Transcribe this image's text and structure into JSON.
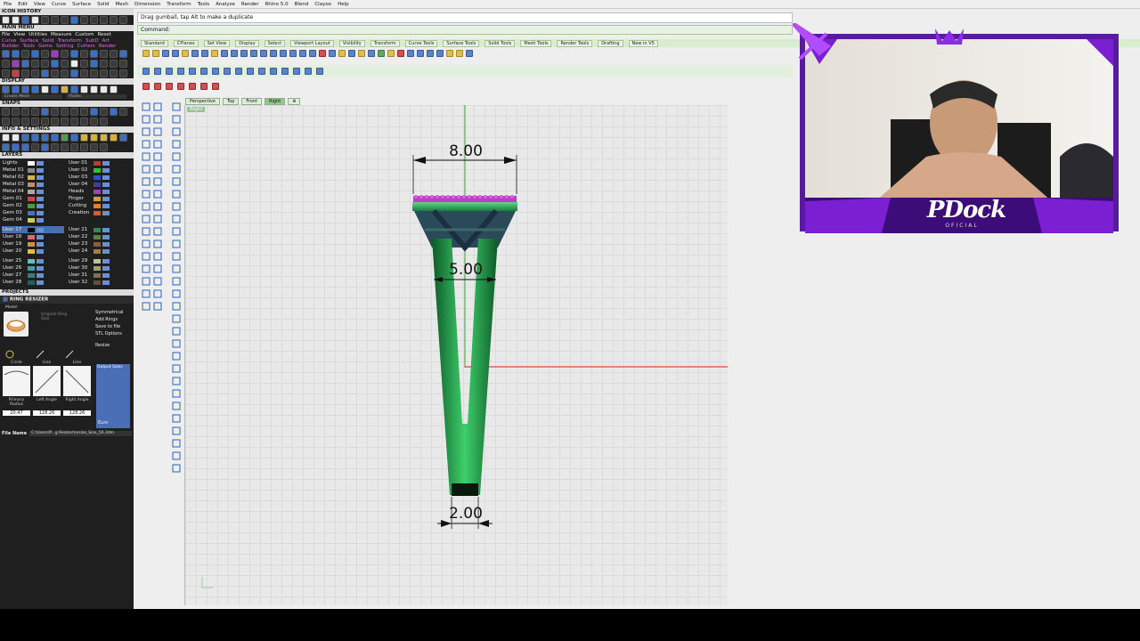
{
  "menubar": {
    "items": [
      "File",
      "Edit",
      "View",
      "Curve",
      "Surface",
      "Solid",
      "Mesh",
      "Dimension",
      "Transform",
      "Tools",
      "Analyze",
      "Render",
      "Rhino 5.0",
      "Blend",
      "Clayoo",
      "Help"
    ]
  },
  "left_panel": {
    "icon_history": "ICON HISTORY",
    "main_menu": "MAIN MENU",
    "menu_row1": [
      "File",
      "View",
      "Utilities",
      "Measure",
      "Custom",
      "Reset"
    ],
    "menu_row2": [
      "Curve",
      "Surface",
      "Solid",
      "Transform",
      "SubD",
      "Art"
    ],
    "menu_row3": [
      "Builder",
      "Tools",
      "Gems",
      "Setting",
      "Cutters",
      "Render"
    ],
    "display": "DISPLAY",
    "display_field1": "Create Mesh",
    "display_field2": "Plastic",
    "snaps": "SNAPS",
    "info_settings": "INFO & SETTINGS",
    "layers": "LAYERS",
    "layers_left": [
      "Lights",
      "Metal 01",
      "Metal 02",
      "Metal 03",
      "Metal 04",
      "Gem 01",
      "Gem 02",
      "Gem 03",
      "Gem 04",
      "User 17",
      "User 18",
      "User 19",
      "User 20",
      "User 25",
      "User 26",
      "User 27",
      "User 28"
    ],
    "layers_right": [
      "User 01",
      "User 02",
      "User 03",
      "User 04",
      "Heads",
      "Finger",
      "Cutting",
      "Creation",
      "User 21",
      "User 22",
      "User 23",
      "User 24",
      "User 29",
      "User 30",
      "User 31",
      "User 32"
    ],
    "layer_header_right": "Hide",
    "projects": "PROJECTS",
    "ring_resizer": "RING RESIZER",
    "model_label": "Model",
    "original_ring_size": "Original Ring Size",
    "options": [
      "Symmetrical",
      "Add Rings",
      "Save to file",
      "STL Options"
    ],
    "resize": "Resize",
    "output_sizes": "Output Sizes",
    "bottom_labels": [
      "Circle",
      "Line",
      "Line"
    ],
    "bottom_sub": [
      "Primary Radius",
      "Left Angle",
      "Right Angle"
    ],
    "bottom_values": [
      "20.47",
      "128.26",
      "128.26"
    ],
    "euro": "Euro",
    "file_name_label": "File Name",
    "file_name_value": "C:\\Users\\P...g Resizer\\resize_Size_56.3dm"
  },
  "status": {
    "prompt": "Drag gumball, tap Alt to make a duplicate",
    "command_label": "Command:"
  },
  "tabs": [
    "Standard",
    "CPlanes",
    "Set View",
    "Display",
    "Select",
    "Viewport Layout",
    "Visibility",
    "Transform",
    "Curve Tools",
    "Surface Tools",
    "Solid Tools",
    "Mesh Tools",
    "Render Tools",
    "Drafting",
    "New in V5"
  ],
  "viewport_tabs": [
    "Perspective",
    "Top",
    "Front",
    "Right"
  ],
  "viewport_active": "Right",
  "viewport_label": "Right",
  "dimensions": {
    "top_width": "8.00",
    "mid_width": "5.00",
    "bottom_width": "2.00"
  },
  "webcam": {
    "brand": "PDock",
    "sub": "OFICIAL"
  },
  "colors": {
    "accent_purple": "#7a1fd1",
    "model_green": "#1c8a3e",
    "gem_pink": "#c03cc8",
    "axis_red": "#d22020",
    "axis_green": "#2ea52e"
  }
}
